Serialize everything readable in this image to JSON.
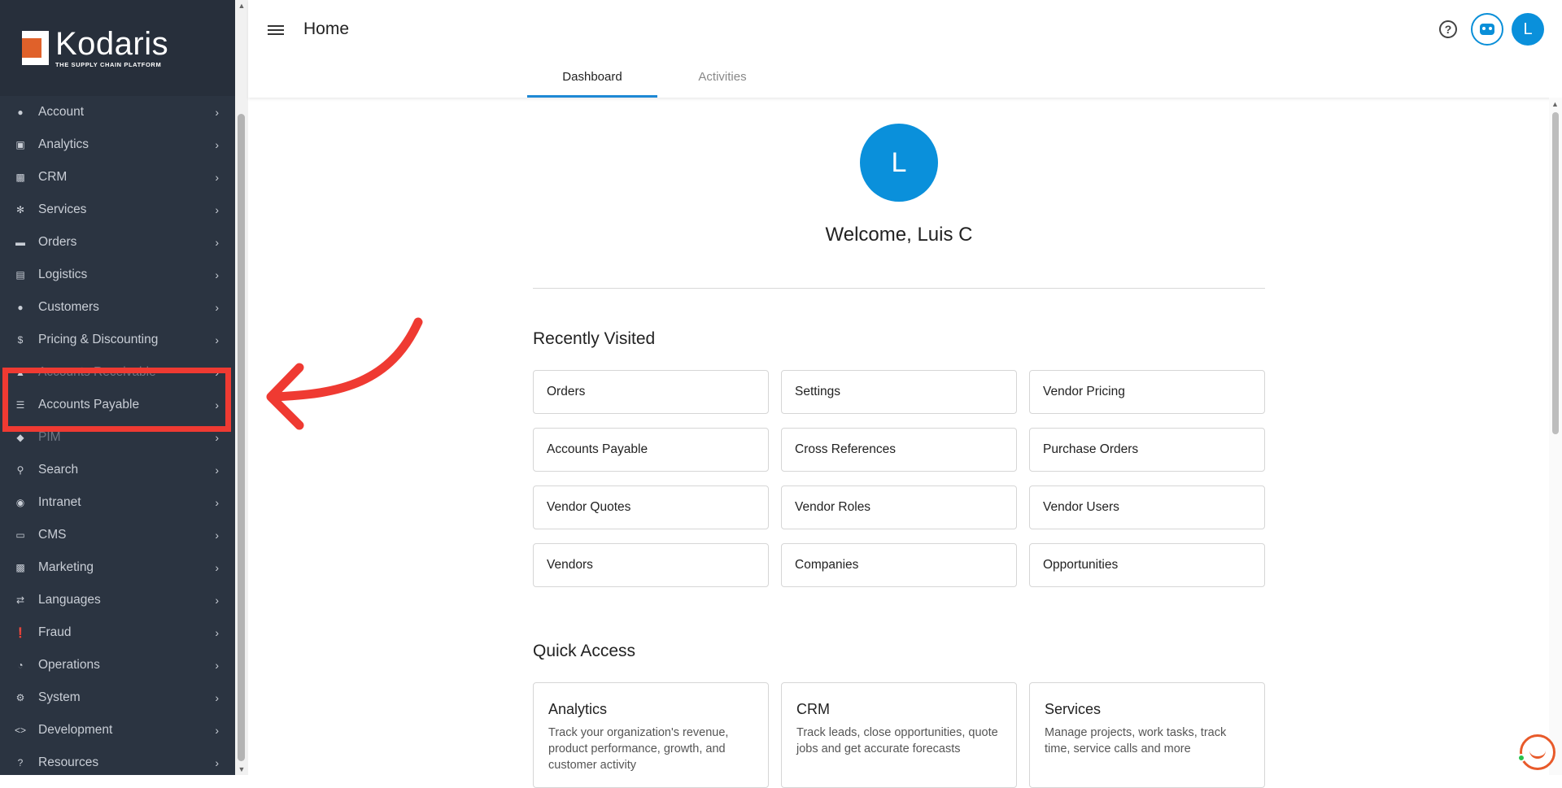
{
  "brand": {
    "name": "Kodaris",
    "tagline": "THE SUPPLY CHAIN PLATFORM"
  },
  "sidebar": {
    "items": [
      {
        "label": "Account",
        "icon": "person-icon"
      },
      {
        "label": "Analytics",
        "icon": "chart-icon"
      },
      {
        "label": "CRM",
        "icon": "contact-card-icon"
      },
      {
        "label": "Services",
        "icon": "gears-icon"
      },
      {
        "label": "Orders",
        "icon": "truck-icon"
      },
      {
        "label": "Logistics",
        "icon": "delivery-truck-icon"
      },
      {
        "label": "Customers",
        "icon": "people-icon"
      },
      {
        "label": "Pricing & Discounting",
        "icon": "dollar-icon"
      },
      {
        "label": "Accounts Receivable",
        "icon": "receivable-icon"
      },
      {
        "label": "Accounts Payable",
        "icon": "bank-icon"
      },
      {
        "label": "PIM",
        "icon": "tag-icon"
      },
      {
        "label": "Search",
        "icon": "search-icon"
      },
      {
        "label": "Intranet",
        "icon": "network-icon"
      },
      {
        "label": "CMS",
        "icon": "cms-icon"
      },
      {
        "label": "Marketing",
        "icon": "marketing-icon"
      },
      {
        "label": "Languages",
        "icon": "translate-icon"
      },
      {
        "label": "Fraud",
        "icon": "alert-icon"
      },
      {
        "label": "Operations",
        "icon": "operations-icon"
      },
      {
        "label": "System",
        "icon": "gear-icon"
      },
      {
        "label": "Development",
        "icon": "code-icon"
      },
      {
        "label": "Resources",
        "icon": "help-icon"
      }
    ]
  },
  "header": {
    "title": "Home",
    "avatar_initial": "L"
  },
  "tabs": [
    {
      "label": "Dashboard"
    },
    {
      "label": "Activities"
    }
  ],
  "welcome": {
    "avatar_initial": "L",
    "text": "Welcome, Luis C"
  },
  "recently_visited": {
    "title": "Recently Visited",
    "items": [
      "Orders",
      "Settings",
      "Vendor Pricing",
      "Accounts Payable",
      "Cross References",
      "Purchase Orders",
      "Vendor Quotes",
      "Vendor Roles",
      "Vendor Users",
      "Vendors",
      "Companies",
      "Opportunities"
    ]
  },
  "quick_access": {
    "title": "Quick Access",
    "items": [
      {
        "title": "Analytics",
        "desc": "Track your organization's revenue, product performance, growth, and customer activity"
      },
      {
        "title": "CRM",
        "desc": "Track leads, close opportunities, quote jobs and get accurate forecasts"
      },
      {
        "title": "Services",
        "desc": "Manage projects, work tasks, track time, service calls and more"
      }
    ]
  },
  "colors": {
    "sidebar_bg": "#2b3441",
    "accent": "#0a90db",
    "highlight": "#ef3a32"
  }
}
